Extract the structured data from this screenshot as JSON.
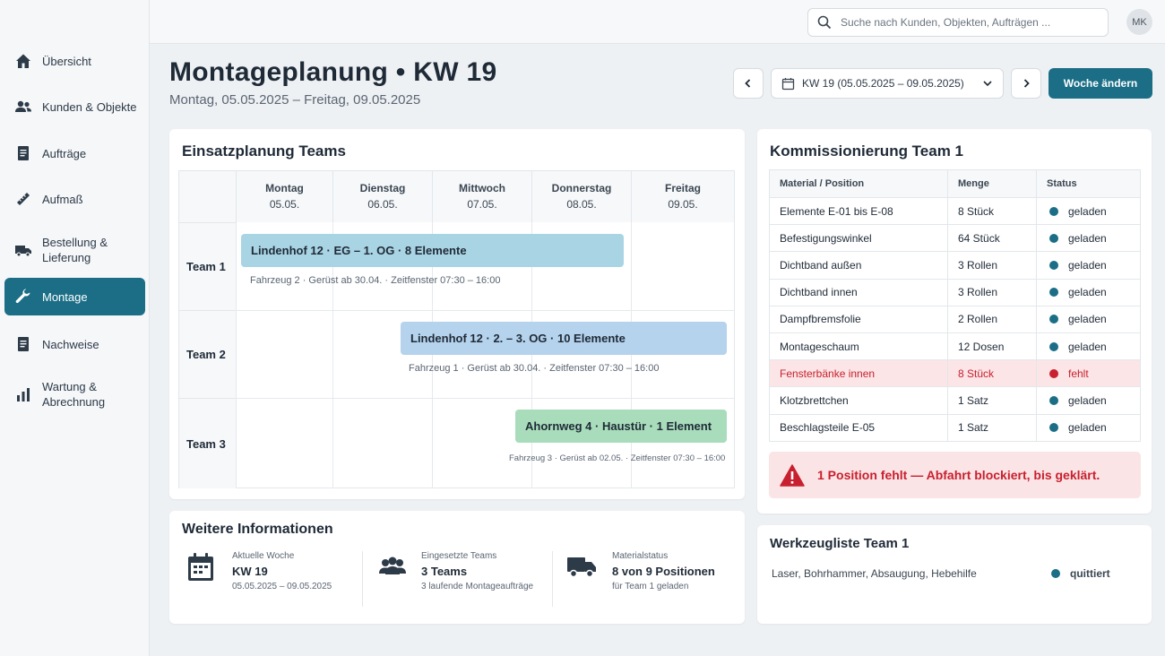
{
  "sidebar": {
    "items": [
      {
        "label": "Übersicht",
        "icon": "home-icon"
      },
      {
        "label": "Kunden & Objekte",
        "icon": "people-icon"
      },
      {
        "label": "Aufträge",
        "icon": "document-icon"
      },
      {
        "label": "Aufmaß",
        "icon": "ruler-icon"
      },
      {
        "label": "Bestellung & Lieferung",
        "icon": "truck-icon"
      },
      {
        "label": "Montage",
        "icon": "wrench-icon",
        "active": true
      },
      {
        "label": "Nachweise",
        "icon": "document-icon"
      },
      {
        "label": "Wartung & Abrechnung",
        "icon": "bar-chart-icon"
      }
    ]
  },
  "topbar": {
    "search_placeholder": "Suche nach Kunden, Objekten, Aufträgen ...",
    "avatar_initials": "MK"
  },
  "header": {
    "title": "Montageplanung • KW 19",
    "subtitle": "Montag, 05.05.2025 – Freitag, 09.05.2025",
    "week_select": "KW 19 (05.05.2025 – 09.05.2025)",
    "change_week_label": "Woche ändern"
  },
  "schedule": {
    "title": "Einsatzplanung Teams",
    "days": [
      {
        "name": "Montag",
        "date": "05.05."
      },
      {
        "name": "Dienstag",
        "date": "06.05."
      },
      {
        "name": "Mittwoch",
        "date": "07.05."
      },
      {
        "name": "Donnerstag",
        "date": "08.05."
      },
      {
        "name": "Freitag",
        "date": "09.05."
      }
    ],
    "teams": [
      {
        "label": "Team  1",
        "bar": "Lindenhof 12  ·  EG – 1. OG  ·  8 Elemente",
        "meta": "Fahrzeug 2 · Gerüst ab 30.04. · Zeitfenster 07:30 – 16:00"
      },
      {
        "label": "Team  2",
        "bar": "Lindenhof 12  ·  2. – 3. OG  ·  10 Elemente",
        "meta": "Fahrzeug 1 · Gerüst ab 30.04. · Zeitfenster 07:30 – 16:00"
      },
      {
        "label": "Team  3",
        "bar": "Ahornweg 4  ·  Haustür  ·  1 Element",
        "meta": "Fahrzeug 3 · Gerüst ab 02.05. · Zeitfenster 07:30 – 16:00"
      }
    ]
  },
  "info": {
    "title": "Weitere Informationen",
    "blocks": [
      {
        "l1": "Aktuelle Woche",
        "l2": "KW 19",
        "l3": "05.05.2025 – 09.05.2025"
      },
      {
        "l1": "Eingesetzte Teams",
        "l2": "3 Teams",
        "l3": "3 laufende Montageaufträge"
      },
      {
        "l1": "Materialstatus",
        "l2": "8 von 9 Positionen",
        "l3": "für Team 1 geladen"
      }
    ]
  },
  "commissioning": {
    "title": "Kommissionierung Team 1",
    "columns": [
      "Material / Position",
      "Menge",
      "Status"
    ],
    "rows": [
      {
        "material": "Elemente E-01 bis E-08",
        "qty": "8 Stück",
        "status": "geladen"
      },
      {
        "material": "Befestigungswinkel",
        "qty": "64 Stück",
        "status": "geladen"
      },
      {
        "material": "Dichtband außen",
        "qty": "3 Rollen",
        "status": "geladen"
      },
      {
        "material": "Dichtband innen",
        "qty": "3 Rollen",
        "status": "geladen"
      },
      {
        "material": "Dampfbremsfolie",
        "qty": "2 Rollen",
        "status": "geladen"
      },
      {
        "material": "Montageschaum",
        "qty": "12 Dosen",
        "status": "geladen"
      },
      {
        "material": "Fensterbänke innen",
        "qty": "8 Stück",
        "status": "fehlt"
      },
      {
        "material": "Klotzbrettchen",
        "qty": "1 Satz",
        "status": "geladen"
      },
      {
        "material": "Beschlagsteile E-05",
        "qty": "1 Satz",
        "status": "geladen"
      }
    ],
    "alert": "1 Position fehlt — Abfahrt blockiert, bis geklärt."
  },
  "tools": {
    "title": "Werkzeugliste Team 1",
    "items": "Laser, Bohrhammer, Absaugung, Hebehilfe",
    "status": "quittiert"
  },
  "colors": {
    "accent": "#1b6e86",
    "team1_bar": "#a9d4e4",
    "team2_bar": "#b5d3ec",
    "team3_bar": "#a8dcbb",
    "ok_dot": "#1b6e86",
    "missing_dot": "#c8202f",
    "missing_bg": "#fbe5e6"
  }
}
